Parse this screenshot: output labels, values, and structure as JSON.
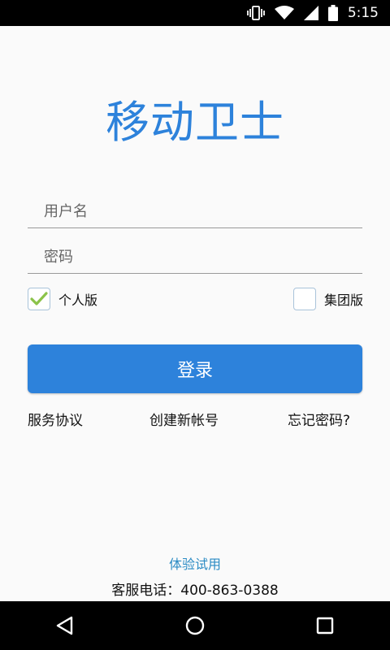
{
  "status_bar": {
    "time": "5:15",
    "icons": [
      "vibrate-icon",
      "wifi-icon",
      "signal-icon",
      "battery-icon"
    ]
  },
  "app": {
    "title": "移动卫士"
  },
  "login_form": {
    "username_placeholder": "用户名",
    "password_placeholder": "密码",
    "username_value": "",
    "password_value": "",
    "personal_label": "个人版",
    "personal_checked": true,
    "group_label": "集团版",
    "group_checked": false,
    "login_label": "登录"
  },
  "links": {
    "service_agreement": "服务协议",
    "create_account": "创建新帐号",
    "forgot_password": "忘记密码?"
  },
  "footer": {
    "trial": "体验试用",
    "phone": "客服电话：400-863-0388"
  },
  "nav_bar": {
    "icons": [
      "back-icon",
      "home-icon",
      "recents-icon"
    ]
  },
  "colors": {
    "accent": "#2d82db",
    "check": "#8bc34a",
    "trial_link": "#2b8bc4"
  }
}
